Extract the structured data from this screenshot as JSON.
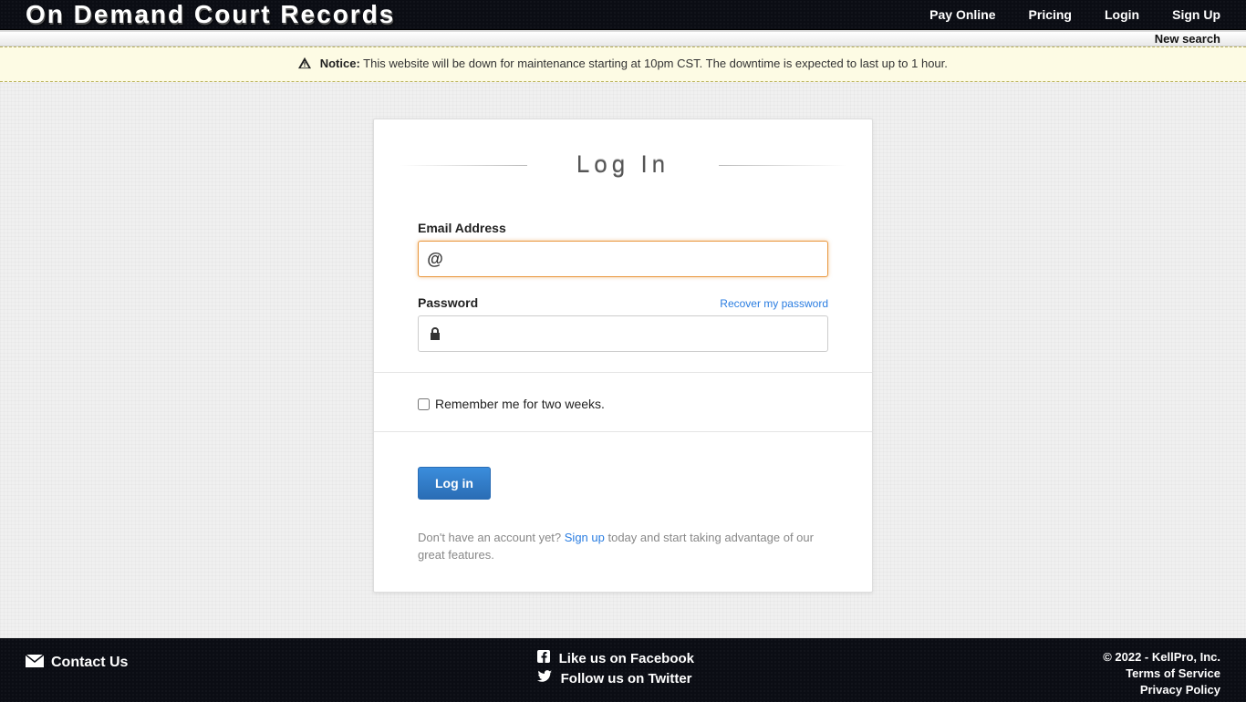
{
  "brand": "On Demand Court Records",
  "nav": {
    "pay_online": "Pay Online",
    "pricing": "Pricing",
    "login": "Login",
    "signup": "Sign Up"
  },
  "subbar": {
    "new_search": "New search"
  },
  "notice": {
    "label": "Notice:",
    "text": "This website will be down for maintenance starting at 10pm CST. The downtime is expected to last up to 1 hour."
  },
  "login": {
    "title": "Log In",
    "email_label": "Email Address",
    "password_label": "Password",
    "recover": "Recover my password",
    "remember": "Remember me for two weeks.",
    "button": "Log in",
    "note_prefix": "Don't have an account yet? ",
    "note_link": "Sign up",
    "note_suffix": " today and start taking advantage of our great features."
  },
  "footer": {
    "contact": "Contact Us",
    "facebook": "Like us on Facebook",
    "twitter": "Follow us on Twitter",
    "copyright": "© 2022 - KellPro, Inc.",
    "tos": "Terms of Service",
    "privacy": "Privacy Policy"
  }
}
